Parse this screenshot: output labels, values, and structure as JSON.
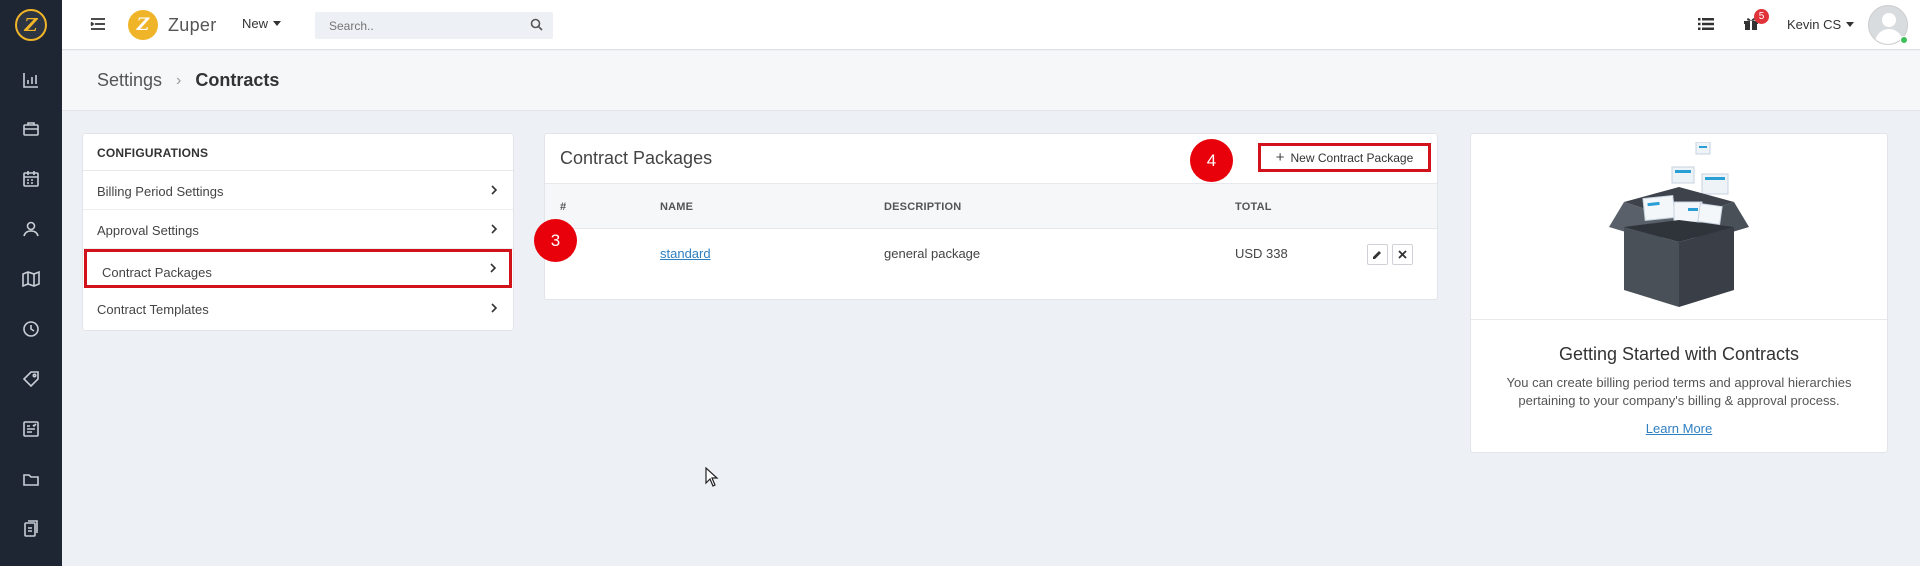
{
  "app": {
    "brand_name": "Zuper",
    "new_label": "New",
    "search_placeholder": "Search..",
    "notification_count": "5",
    "user_name": "Kevin CS"
  },
  "rail": {
    "icons": [
      "dashboard-icon",
      "jobs-briefcase-icon",
      "calendar-icon",
      "customers-icon",
      "map-icon",
      "timesheet-clock-icon",
      "tags-icon",
      "reports-icon",
      "folder-icon",
      "documents-icon"
    ]
  },
  "breadcrumb": {
    "parent": "Settings",
    "separator": "›",
    "current": "Contracts"
  },
  "config": {
    "header": "CONFIGURATIONS",
    "items": [
      {
        "label": "Billing Period Settings"
      },
      {
        "label": "Approval Settings"
      },
      {
        "label": "Contract Packages"
      },
      {
        "label": "Contract Templates"
      }
    ]
  },
  "packages": {
    "title": "Contract Packages",
    "new_button": "New Contract Package",
    "columns": [
      "#",
      "NAME",
      "DESCRIPTION",
      "TOTAL"
    ],
    "rows": [
      {
        "name": "standard",
        "description": "general package",
        "total": "USD 338"
      }
    ]
  },
  "steps": {
    "step3": "3",
    "step4": "4"
  },
  "getting_started": {
    "title": "Getting Started with Contracts",
    "description": "You can create billing period terms and approval hierarchies pertaining to your company's billing & approval process.",
    "link": "Learn More"
  },
  "colors": {
    "rail_bg": "#1f2633",
    "brand_yellow": "#f0b429",
    "highlight_red": "#d1121a",
    "link_blue": "#2f7fc1"
  }
}
